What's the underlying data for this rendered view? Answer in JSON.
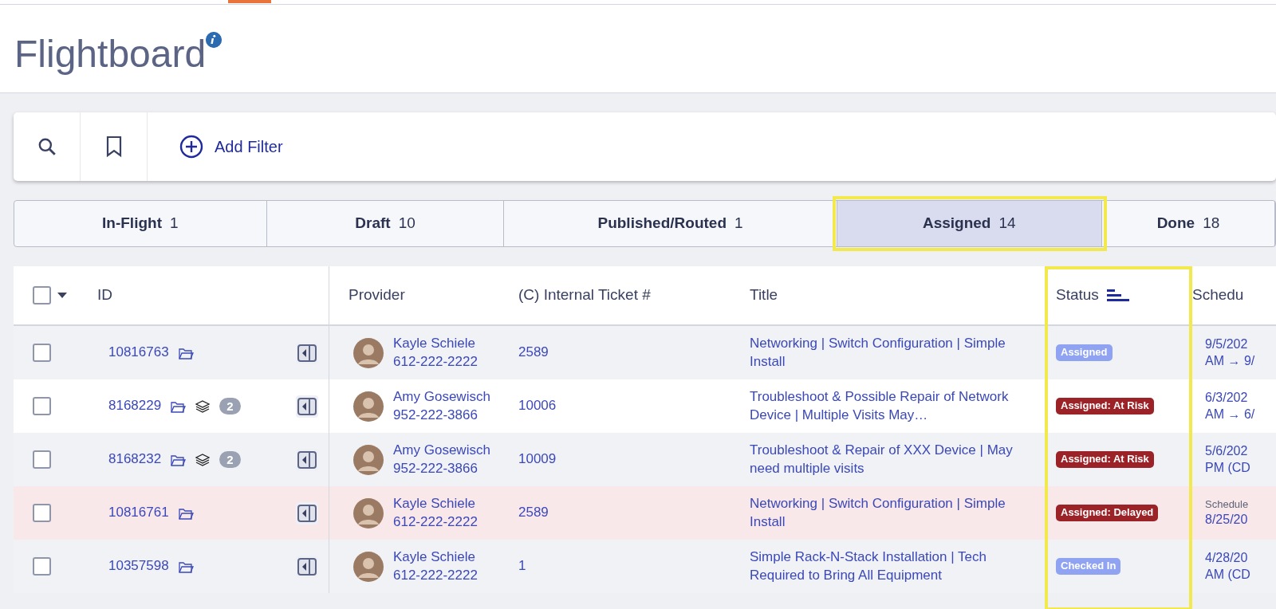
{
  "page": {
    "title": "Flightboard"
  },
  "toolbar": {
    "add_filter": "Add Filter"
  },
  "tabs": [
    {
      "label": "In-Flight",
      "count": "1",
      "selected": false,
      "highlighted": false
    },
    {
      "label": "Draft",
      "count": "10",
      "selected": false,
      "highlighted": false
    },
    {
      "label": "Published/Routed",
      "count": "1",
      "selected": false,
      "highlighted": false
    },
    {
      "label": "Assigned",
      "count": "14",
      "selected": true,
      "highlighted": true
    },
    {
      "label": "Done",
      "count": "18",
      "selected": false,
      "highlighted": false
    }
  ],
  "table": {
    "select_all": {
      "checked": false
    },
    "columns": [
      {
        "label": "ID",
        "kind": "id"
      },
      {
        "label": "Provider",
        "kind": "provider"
      },
      {
        "label": "(C) Internal Ticket #",
        "kind": "ticket"
      },
      {
        "label": "Title",
        "kind": "title"
      },
      {
        "label": "Status",
        "kind": "status",
        "highlighted": true,
        "sorted": true
      },
      {
        "label": "Schedu",
        "kind": "schedule"
      }
    ],
    "rows": [
      {
        "checked": false,
        "alert": false,
        "id": "10816763",
        "linked_count": null,
        "provider": "Kayle Schiele",
        "phone": "612-222-2222",
        "ticket": "2589",
        "title": "Networking | Switch Configuration | Simple Install",
        "status": {
          "label": "Assigned",
          "color": "#8fa3f2"
        },
        "schedule": [
          {
            "kind": "date",
            "text": "9/5/202"
          },
          {
            "kind": "date",
            "text": "AM → 9/"
          }
        ]
      },
      {
        "checked": false,
        "alert": false,
        "id": "8168229",
        "linked_count": "2",
        "provider": "Amy Gosewisch",
        "phone": "952-222-3866",
        "ticket": "10006",
        "title": "Troubleshoot & Possible Repair of Network Device | Multiple Visits May…",
        "status": {
          "label": "Assigned: At Risk",
          "color": "#9b2226"
        },
        "schedule": [
          {
            "kind": "date",
            "text": "6/3/202"
          },
          {
            "kind": "date",
            "text": "AM → 6/"
          }
        ]
      },
      {
        "checked": false,
        "alert": false,
        "id": "8168232",
        "linked_count": "2",
        "provider": "Amy Gosewisch",
        "phone": "952-222-3866",
        "ticket": "10009",
        "title": "Troubleshoot & Repair of XXX Device | May need multiple visits",
        "status": {
          "label": "Assigned: At Risk",
          "color": "#9b2226"
        },
        "schedule": [
          {
            "kind": "date",
            "text": "5/6/202"
          },
          {
            "kind": "date",
            "text": "PM (CD"
          }
        ]
      },
      {
        "checked": false,
        "alert": true,
        "id": "10816761",
        "linked_count": null,
        "provider": "Kayle Schiele",
        "phone": "612-222-2222",
        "ticket": "2589",
        "title": "Networking | Switch Configuration | Simple Install",
        "status": {
          "label": "Assigned: Delayed",
          "color": "#9b2226"
        },
        "schedule": [
          {
            "kind": "note",
            "text": "Schedule"
          },
          {
            "kind": "date",
            "text": "8/25/20"
          }
        ]
      },
      {
        "checked": false,
        "alert": false,
        "id": "10357598",
        "linked_count": null,
        "provider": "Kayle Schiele",
        "phone": "612-222-2222",
        "ticket": "1",
        "title": "Simple Rack-N-Stack Installation | Tech Required to Bring All Equipment",
        "status": {
          "label": "Checked In",
          "color": "#8fa3f2"
        },
        "schedule": [
          {
            "kind": "date",
            "text": "4/28/20"
          },
          {
            "kind": "date",
            "text": "AM (CD"
          }
        ]
      }
    ]
  }
}
